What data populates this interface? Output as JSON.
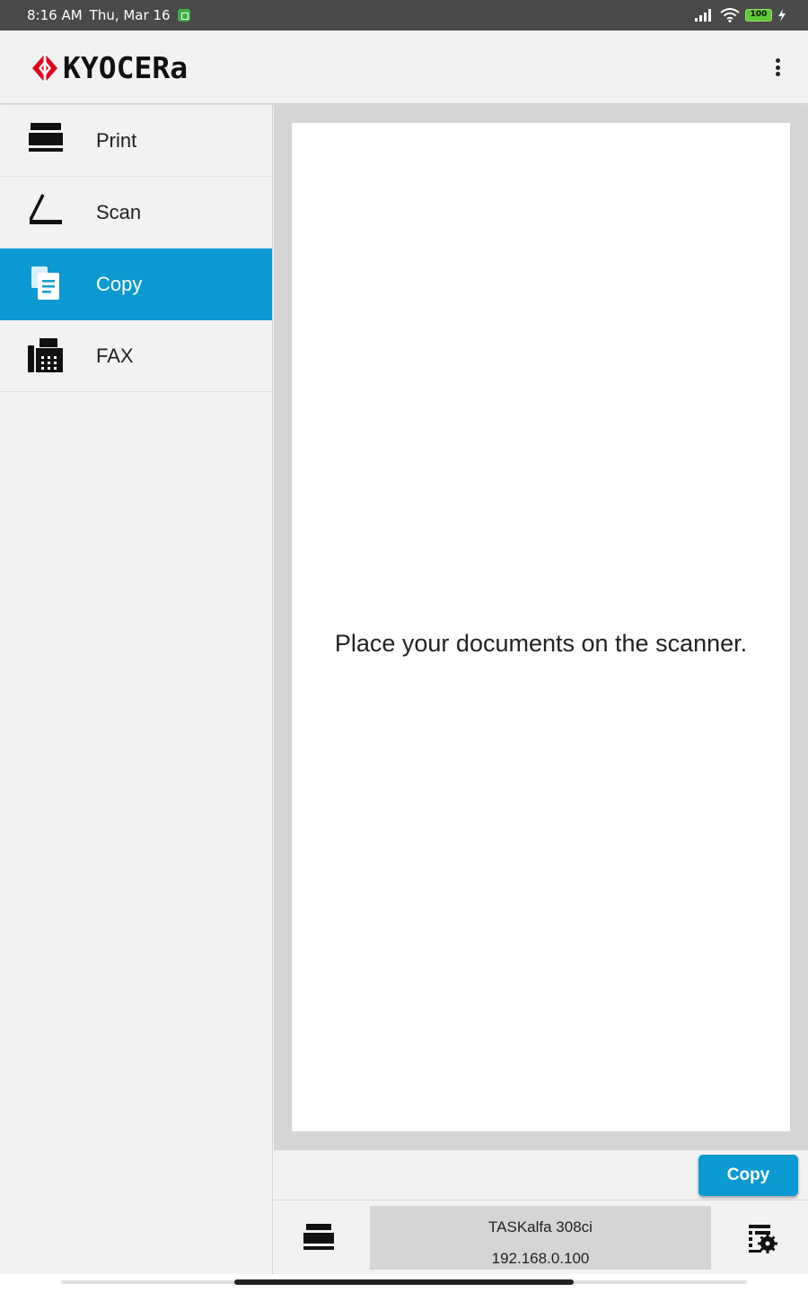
{
  "status_bar": {
    "time": "8:16 AM",
    "date": "Thu, Mar 16",
    "battery": "100"
  },
  "app_bar": {
    "logo_text": "KYOCERa",
    "brand_color": "#e2001a"
  },
  "sidebar": {
    "items": [
      {
        "label": "Print",
        "icon": "printer-icon",
        "active": false
      },
      {
        "label": "Scan",
        "icon": "scanner-icon",
        "active": false
      },
      {
        "label": "Copy",
        "icon": "copy-icon",
        "active": true
      },
      {
        "label": "FAX",
        "icon": "fax-icon",
        "active": false
      }
    ],
    "active_color": "#0b99d1"
  },
  "main": {
    "preview_message": "Place your documents on the scanner."
  },
  "action_bar": {
    "copy_label": "Copy"
  },
  "device": {
    "name": "TASKalfa 308ci",
    "ip": "192.168.0.100"
  }
}
